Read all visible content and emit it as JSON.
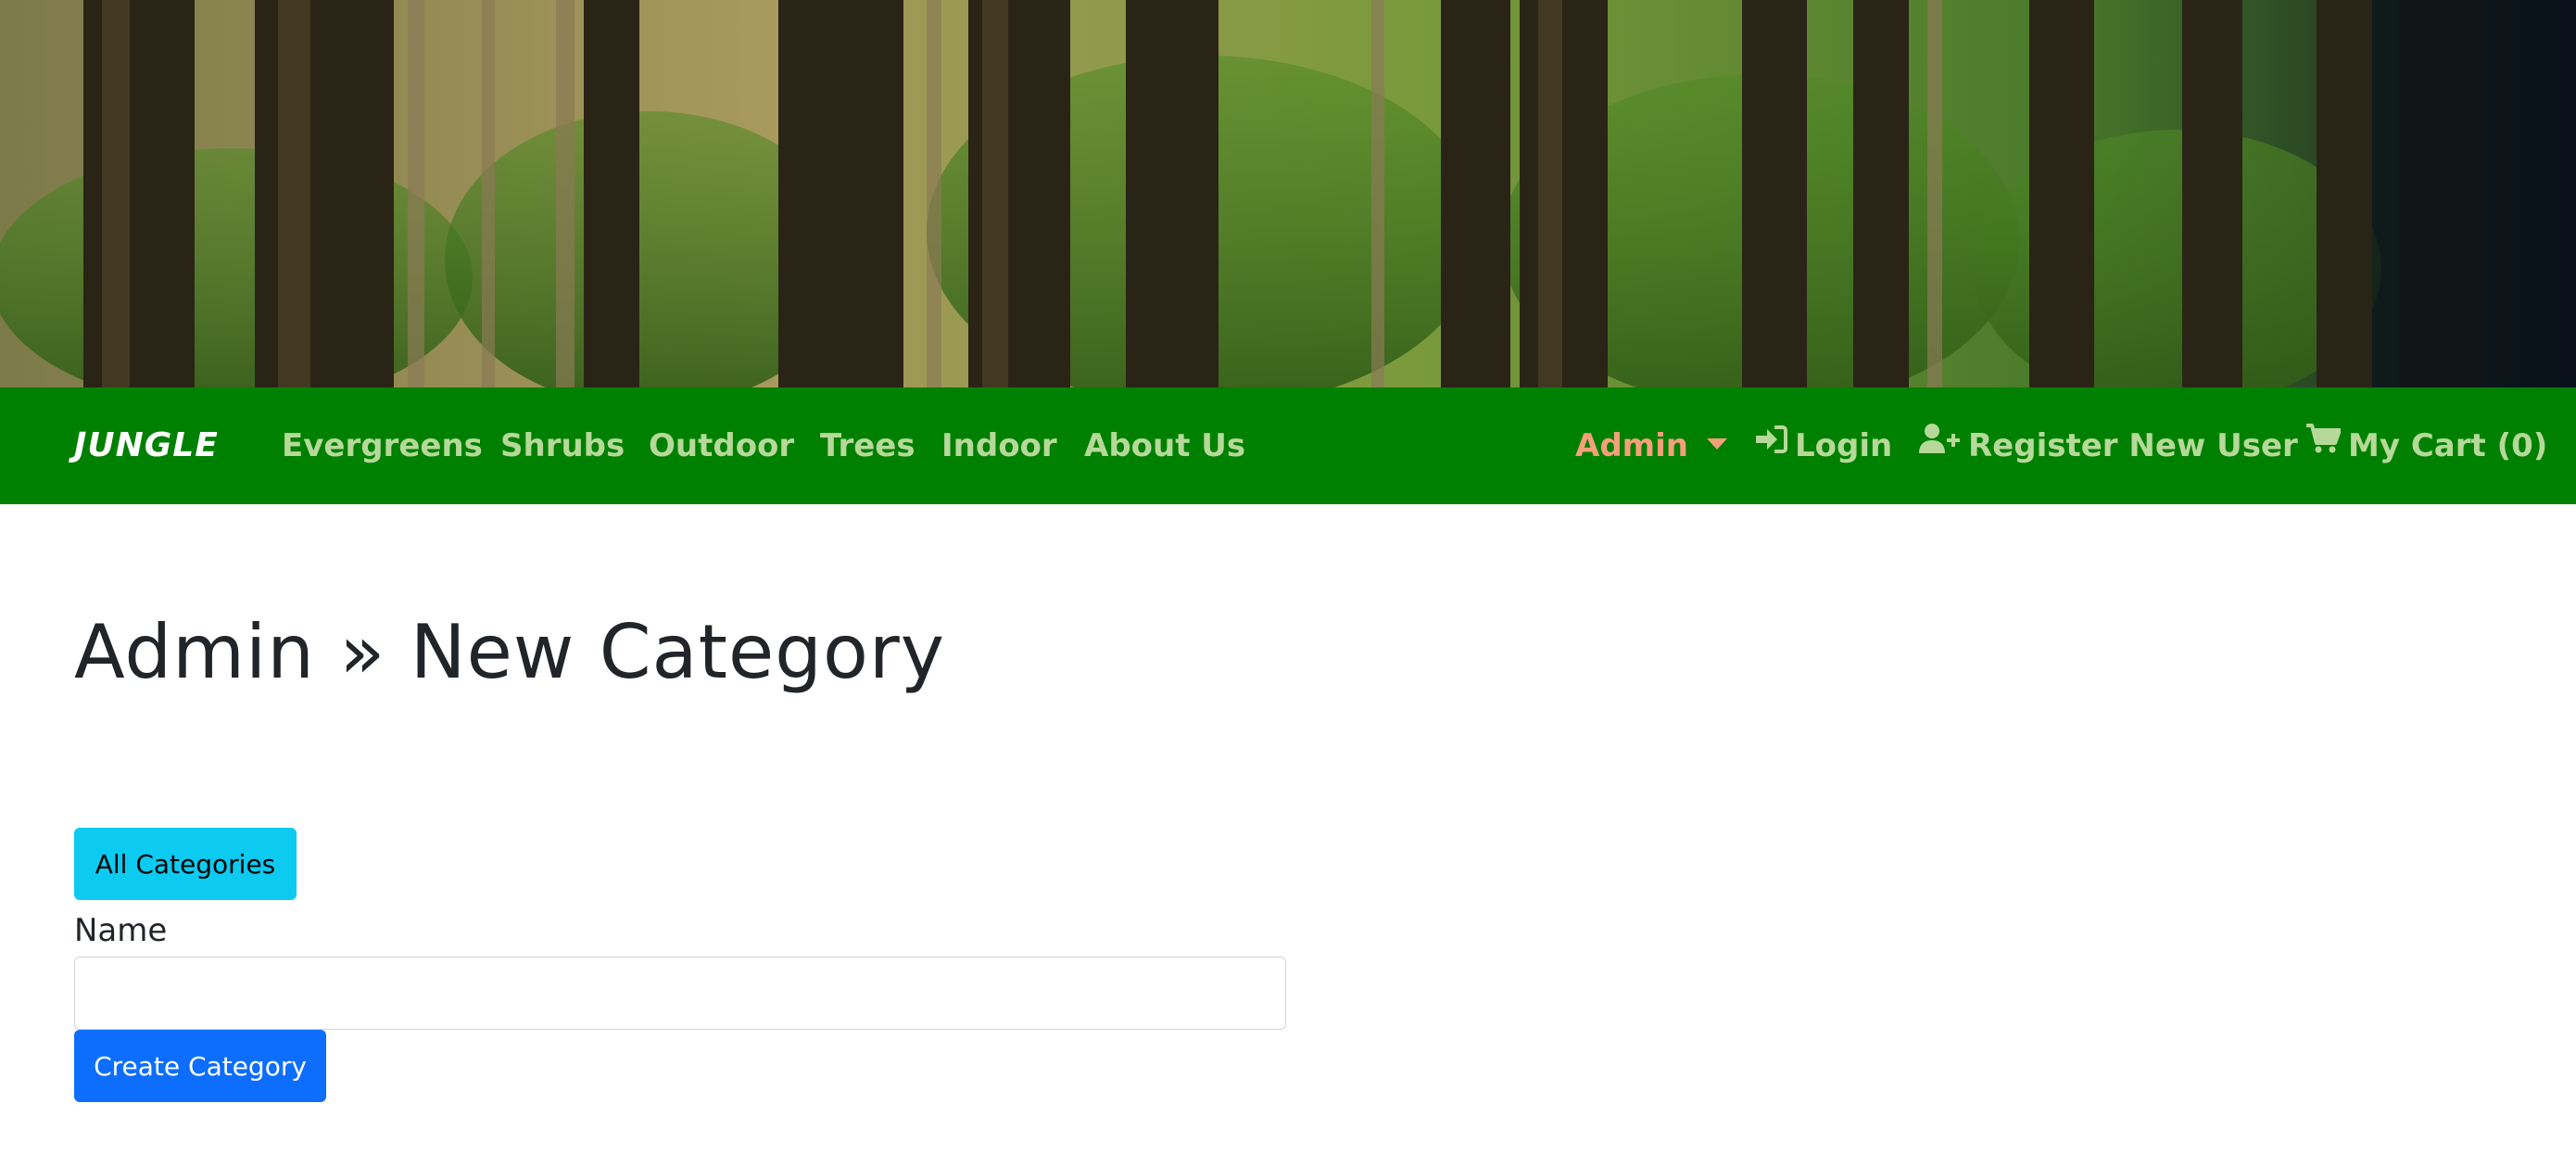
{
  "banner": {
    "alt": "forest banner"
  },
  "navbar": {
    "brand": "JUNGLE",
    "links": [
      "Evergreens",
      "Shrubs",
      "Outdoor",
      "Trees",
      "Indoor",
      "About Us"
    ],
    "admin": "Admin",
    "login": "Login",
    "register": "Register New User",
    "cart": "My Cart (0)"
  },
  "page": {
    "title": "Admin » New Category",
    "all_categories_button": "All Categories",
    "name_label": "Name",
    "name_value": "",
    "create_button": "Create Category"
  },
  "colors": {
    "navbar": "#008000",
    "nav_link": "#b6d99a",
    "admin": "#f4a07a",
    "info_button": "#0dcaf0",
    "primary_button": "#0d6efd"
  },
  "icons": {
    "admin": "caret-down-icon",
    "login": "sign-in-icon",
    "register": "user-plus-icon",
    "cart": "shopping-cart-icon"
  }
}
